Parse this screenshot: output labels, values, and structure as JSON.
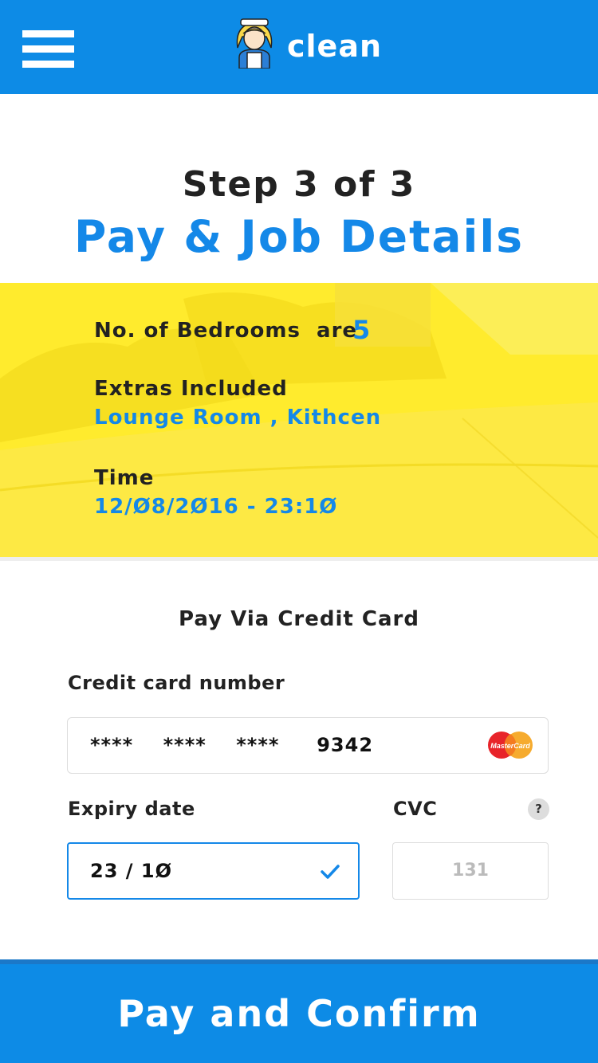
{
  "header": {
    "brand": "clean",
    "background": "#0d8be6",
    "menu_icon": "hamburger-menu-icon",
    "logo_icon": "cleaner-woman-icon"
  },
  "intro": {
    "step": "Step 3 of 3",
    "title": "Pay & Job Details"
  },
  "summary": {
    "background": "#ffeb2d",
    "bedrooms_label": "No. of Bedrooms  are",
    "bedrooms_count": "5",
    "extras_label": "Extras Included",
    "extras_value": "Lounge Room , Kithcen",
    "time_label": "Time",
    "time_value": "12/Ø8/2Ø16 - 23:1Ø"
  },
  "payment": {
    "heading": "Pay Via Credit Card",
    "card_number_label": "Credit card number",
    "card_number_value": "****    ****    ****     9342",
    "card_brand_icon": "mastercard-icon",
    "card_brand_text": "MasterCard",
    "expiry_label": "Expiry date",
    "expiry_value": "23 / 1Ø",
    "cvc_label": "CVC",
    "cvc_help": "?",
    "cvc_placeholder": "131"
  },
  "footer": {
    "confirm_label": "Pay and Confirm"
  },
  "colors": {
    "accent": "#1488e8",
    "text": "#222222",
    "border": "#dddddd"
  }
}
